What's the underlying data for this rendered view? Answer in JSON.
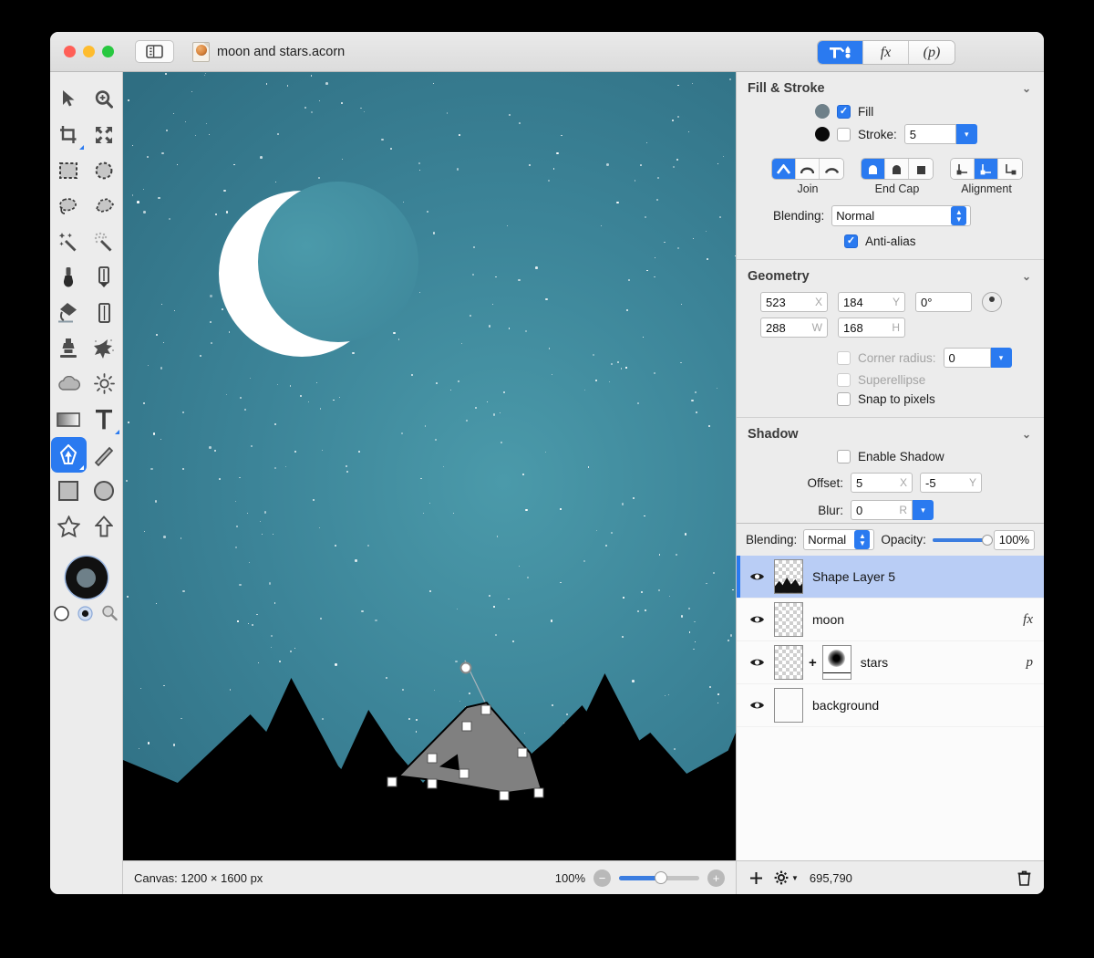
{
  "window": {
    "document_title": "moon and stars.acorn",
    "doc_icon": "acorn-document-icon",
    "sidebar_toggle_icon": "sidebar-toggle-icon",
    "traffic_lights": [
      "close",
      "minimize",
      "zoom"
    ]
  },
  "inspector_tabs": [
    {
      "label": "T!",
      "name": "tab-tools",
      "active": true
    },
    {
      "label": "fx",
      "name": "tab-effects",
      "active": false
    },
    {
      "label": "(p)",
      "name": "tab-palette",
      "active": false
    }
  ],
  "tools": [
    {
      "name": "move-tool",
      "icon": "arrow-cursor-icon"
    },
    {
      "name": "zoom-tool",
      "icon": "magnifier-plus-icon"
    },
    {
      "name": "crop-tool",
      "icon": "crop-icon"
    },
    {
      "name": "transform-tool",
      "icon": "arrows-expand-icon"
    },
    {
      "name": "rectangle-select-tool",
      "icon": "marquee-rect-icon"
    },
    {
      "name": "ellipse-select-tool",
      "icon": "marquee-ellipse-icon"
    },
    {
      "name": "lasso-tool",
      "icon": "lasso-icon"
    },
    {
      "name": "polygon-lasso-tool",
      "icon": "polygon-lasso-icon"
    },
    {
      "name": "magic-wand-tool",
      "icon": "magic-wand-icon"
    },
    {
      "name": "instant-alpha-tool",
      "icon": "dotted-wand-icon"
    },
    {
      "name": "brush-tool",
      "icon": "brush-icon"
    },
    {
      "name": "pencil-tool",
      "icon": "pencil-icon"
    },
    {
      "name": "paint-bucket-tool",
      "icon": "paint-bucket-icon"
    },
    {
      "name": "eraser-tool",
      "icon": "eraser-icon"
    },
    {
      "name": "clone-stamp-tool",
      "icon": "clone-stamp-icon"
    },
    {
      "name": "smudge-tool",
      "icon": "smudge-icon"
    },
    {
      "name": "blur-tool",
      "icon": "cloud-icon"
    },
    {
      "name": "dodge-tool",
      "icon": "sun-icon"
    },
    {
      "name": "gradient-tool",
      "icon": "gradient-icon"
    },
    {
      "name": "text-tool",
      "icon": "text-t-icon"
    },
    {
      "name": "pen-tool",
      "icon": "pen-nib-icon",
      "selected": true
    },
    {
      "name": "line-tool",
      "icon": "line-icon"
    },
    {
      "name": "rectangle-shape-tool",
      "icon": "square-icon"
    },
    {
      "name": "ellipse-shape-tool",
      "icon": "circle-icon"
    },
    {
      "name": "star-shape-tool",
      "icon": "star-icon"
    },
    {
      "name": "arrow-shape-tool",
      "icon": "arrow-up-icon"
    }
  ],
  "color_well": {
    "foreground": "#6e8089",
    "background": "#111111",
    "extras": [
      {
        "name": "swap-colors-icon",
        "icon": "half-circle-icon"
      },
      {
        "name": "default-colors-icon",
        "icon": "target-dot-icon"
      },
      {
        "name": "color-picker-icon",
        "icon": "magnifier-icon"
      }
    ]
  },
  "fill_stroke": {
    "title": "Fill & Stroke",
    "fill": {
      "label": "Fill",
      "checked": true,
      "color": "#6e8089"
    },
    "stroke": {
      "label": "Stroke:",
      "checked": false,
      "color": "#0a0a0a",
      "width": "5"
    },
    "join": {
      "caption": "Join",
      "options": [
        "miter",
        "round",
        "bevel"
      ],
      "selected_index": 0
    },
    "end_cap": {
      "caption": "End Cap",
      "options": [
        "butt",
        "round",
        "square"
      ],
      "selected_index": 0
    },
    "alignment": {
      "caption": "Alignment",
      "options": [
        "inside",
        "center",
        "outside"
      ],
      "selected_index": 1
    },
    "blending": {
      "label": "Blending:",
      "value": "Normal"
    },
    "antialias": {
      "label": "Anti-alias",
      "checked": true
    }
  },
  "geometry": {
    "title": "Geometry",
    "x": {
      "value": "523",
      "unit": "X"
    },
    "y": {
      "value": "184",
      "unit": "Y"
    },
    "rotation": {
      "value": "0°"
    },
    "w": {
      "value": "288",
      "unit": "W"
    },
    "h": {
      "value": "168",
      "unit": "H"
    },
    "corner_radius": {
      "label": "Corner radius:",
      "checked": false,
      "enabled": false,
      "value": "0"
    },
    "superellipse": {
      "label": "Superellipse",
      "checked": false,
      "enabled": false
    },
    "snap_to_pixels": {
      "label": "Snap to pixels",
      "checked": false,
      "enabled": true
    }
  },
  "shadow": {
    "title": "Shadow",
    "enable": {
      "label": "Enable Shadow",
      "checked": false
    },
    "offset": {
      "label": "Offset:",
      "x": "5",
      "x_unit": "X",
      "y": "-5",
      "y_unit": "Y"
    },
    "blur": {
      "label": "Blur:",
      "value": "0",
      "unit": "R"
    }
  },
  "layers_header": {
    "blending_label": "Blending:",
    "blending_value": "Normal",
    "opacity_label": "Opacity:",
    "opacity_value": "100%"
  },
  "layers": [
    {
      "name": "Shape Layer 5",
      "selected": true,
      "visible": true,
      "badge": "",
      "thumb": "mountains",
      "has_mask": false
    },
    {
      "name": "moon",
      "selected": false,
      "visible": true,
      "badge": "fx",
      "thumb": "moon",
      "has_mask": false
    },
    {
      "name": "stars",
      "selected": false,
      "visible": true,
      "badge": "p",
      "thumb": "stars",
      "has_mask": true
    },
    {
      "name": "background",
      "selected": false,
      "visible": true,
      "badge": "",
      "thumb": "background",
      "has_mask": false
    }
  ],
  "layer_footer": {
    "add_icon": "plus-icon",
    "settings_icon": "gear-dropdown-icon",
    "count": "695,790",
    "delete_icon": "trash-icon"
  },
  "status_bar": {
    "canvas_info": "Canvas: 1200 × 1600 px",
    "zoom_percent": "100%",
    "zoom_out_icon": "minus-circle-icon",
    "zoom_in_icon": "plus-circle-icon"
  },
  "canvas_art": {
    "background_gradient_from": "#4b9aaa",
    "background_gradient_to": "#2f6e82",
    "moon_color": "#ffffff",
    "mountain_color": "#000000",
    "selected_shape_color": "#808080",
    "description": "Night sky with crescent moon, star field, black mountain silhouettes and one selected gray mountain shape with editing handles"
  }
}
